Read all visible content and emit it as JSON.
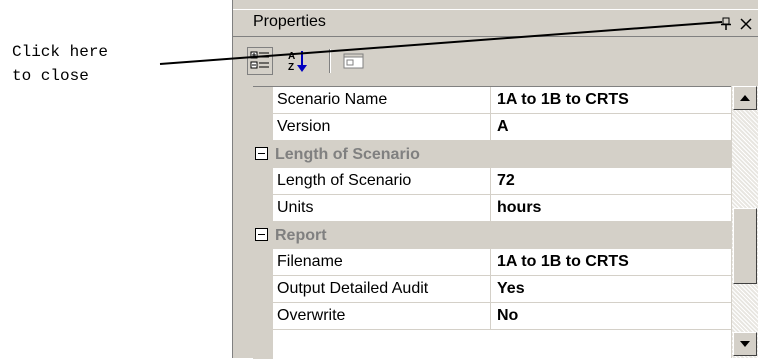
{
  "callout": {
    "line1": "Click here",
    "line2": "to close"
  },
  "panel": {
    "title": "Properties",
    "toolbar": {
      "categorized_icon": "categorized-view-icon",
      "alphabetical_icon": "alphabetical-sort-icon",
      "property_pages_icon": "property-pages-icon"
    },
    "rows": [
      {
        "kind": "property",
        "name": "Scenario Name",
        "value": "1A to 1B to CRTS"
      },
      {
        "kind": "property",
        "name": "Version",
        "value": "A"
      },
      {
        "kind": "category",
        "name": "Length of Scenario"
      },
      {
        "kind": "property",
        "name": "Length of Scenario",
        "value": "72"
      },
      {
        "kind": "property",
        "name": "Units",
        "value": "hours"
      },
      {
        "kind": "category",
        "name": "Report"
      },
      {
        "kind": "property",
        "name": "Filename",
        "value": "1A to 1B to CRTS"
      },
      {
        "kind": "property",
        "name": "Output Detailed Audit",
        "value": "Yes"
      },
      {
        "kind": "property",
        "name": "Overwrite",
        "value": "No"
      }
    ]
  },
  "colors": {
    "panel_bg": "#d4d0c8",
    "category_text": "#808080"
  }
}
